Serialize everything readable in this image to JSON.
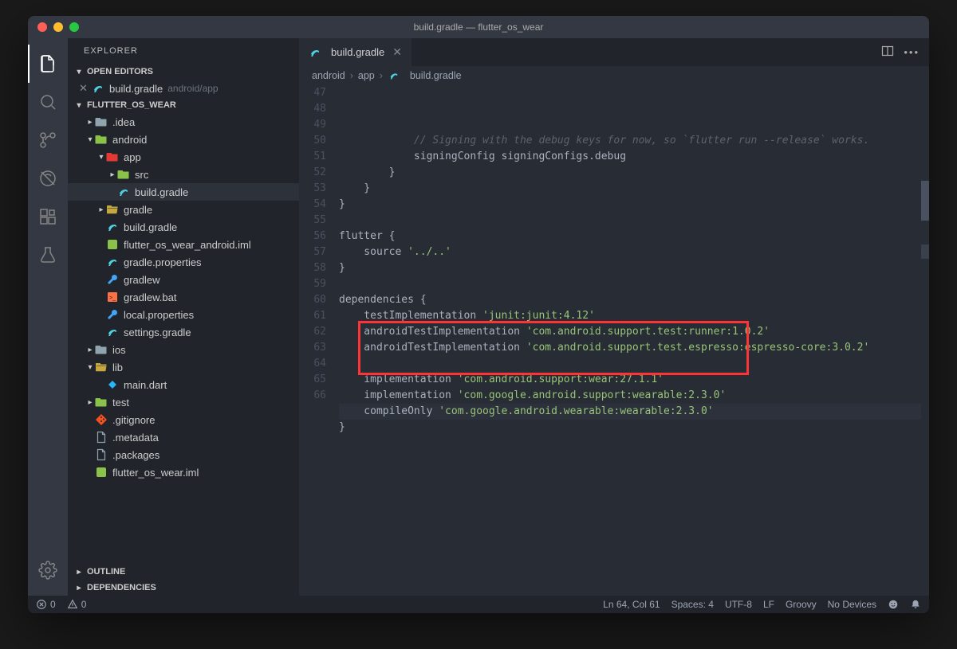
{
  "window": {
    "title": "build.gradle — flutter_os_wear"
  },
  "sidebar": {
    "title": "EXPLORER",
    "sections": {
      "openEditors": "OPEN EDITORS",
      "workspace": "FLUTTER_OS_WEAR",
      "outline": "OUTLINE",
      "dependencies": "DEPENDENCIES"
    },
    "openEditor": {
      "name": "build.gradle",
      "detail": "android/app"
    },
    "tree": [
      {
        "name": ".idea",
        "depth": 1,
        "type": "folder",
        "chev": "▸"
      },
      {
        "name": "android",
        "depth": 1,
        "type": "folder-android",
        "chev": "▾"
      },
      {
        "name": "app",
        "depth": 2,
        "type": "folder-app",
        "chev": "▾"
      },
      {
        "name": "src",
        "depth": 3,
        "type": "folder-android",
        "chev": "▸"
      },
      {
        "name": "build.gradle",
        "depth": 3,
        "type": "gradle",
        "active": true
      },
      {
        "name": "gradle",
        "depth": 2,
        "type": "folder-open",
        "chev": "▸"
      },
      {
        "name": "build.gradle",
        "depth": 2,
        "type": "gradle"
      },
      {
        "name": "flutter_os_wear_android.iml",
        "depth": 2,
        "type": "green"
      },
      {
        "name": "gradle.properties",
        "depth": 2,
        "type": "gradle"
      },
      {
        "name": "gradlew",
        "depth": 2,
        "type": "wrench"
      },
      {
        "name": "gradlew.bat",
        "depth": 2,
        "type": "orange"
      },
      {
        "name": "local.properties",
        "depth": 2,
        "type": "wrench"
      },
      {
        "name": "settings.gradle",
        "depth": 2,
        "type": "gradle"
      },
      {
        "name": "ios",
        "depth": 1,
        "type": "folder",
        "chev": "▸"
      },
      {
        "name": "lib",
        "depth": 1,
        "type": "folder-open",
        "chev": "▾"
      },
      {
        "name": "main.dart",
        "depth": 2,
        "type": "dart"
      },
      {
        "name": "test",
        "depth": 1,
        "type": "folder-android",
        "chev": "▸"
      },
      {
        "name": ".gitignore",
        "depth": 1,
        "type": "git"
      },
      {
        "name": ".metadata",
        "depth": 1,
        "type": "file"
      },
      {
        "name": ".packages",
        "depth": 1,
        "type": "file"
      },
      {
        "name": "flutter_os_wear.iml",
        "depth": 1,
        "type": "green"
      }
    ]
  },
  "tab": {
    "name": "build.gradle"
  },
  "breadcrumbs": [
    "android",
    "app",
    "build.gradle"
  ],
  "code": {
    "startLine": 47,
    "highlightLine": 64,
    "lines": [
      {
        "n": 47,
        "segs": [
          [
            "            ",
            "p"
          ],
          [
            "// Signing with the debug keys for now, so `flutter run --release` works.",
            "c"
          ]
        ]
      },
      {
        "n": 48,
        "segs": [
          [
            "            signingConfig signingConfigs",
            "i"
          ],
          [
            ".",
            "p"
          ],
          [
            "debug",
            "i"
          ]
        ]
      },
      {
        "n": 49,
        "segs": [
          [
            "        }",
            "p"
          ]
        ]
      },
      {
        "n": 50,
        "segs": [
          [
            "    }",
            "p"
          ]
        ]
      },
      {
        "n": 51,
        "segs": [
          [
            "}",
            "p"
          ]
        ]
      },
      {
        "n": 52,
        "segs": [
          [
            "",
            ""
          ]
        ]
      },
      {
        "n": 53,
        "segs": [
          [
            "flutter ",
            "i"
          ],
          [
            "{",
            "p"
          ]
        ]
      },
      {
        "n": 54,
        "segs": [
          [
            "    source ",
            "i"
          ],
          [
            "'../..'",
            "s"
          ]
        ]
      },
      {
        "n": 55,
        "segs": [
          [
            "}",
            "p"
          ]
        ]
      },
      {
        "n": 56,
        "segs": [
          [
            "",
            ""
          ]
        ]
      },
      {
        "n": 57,
        "segs": [
          [
            "dependencies ",
            "i"
          ],
          [
            "{",
            "p"
          ]
        ]
      },
      {
        "n": 58,
        "segs": [
          [
            "    testImplementation ",
            "i"
          ],
          [
            "'junit:junit:4.12'",
            "s"
          ]
        ]
      },
      {
        "n": 59,
        "segs": [
          [
            "    androidTestImplementation ",
            "i"
          ],
          [
            "'com.android.support.test:runner:1.0.2'",
            "s"
          ]
        ]
      },
      {
        "n": 60,
        "segs": [
          [
            "    androidTestImplementation ",
            "i"
          ],
          [
            "'com.android.support.test.espresso:espresso-core:3.0.2'",
            "s"
          ]
        ]
      },
      {
        "n": 61,
        "segs": [
          [
            "",
            ""
          ]
        ]
      },
      {
        "n": 62,
        "segs": [
          [
            "    implementation ",
            "i"
          ],
          [
            "'com.android.support:wear:27.1.1'",
            "s"
          ]
        ]
      },
      {
        "n": 63,
        "segs": [
          [
            "    implementation ",
            "i"
          ],
          [
            "'com.google.android.support:wearable:2.3.0'",
            "s"
          ]
        ]
      },
      {
        "n": 64,
        "segs": [
          [
            "    compileOnly ",
            "i"
          ],
          [
            "'com.google.android.wearable:wearable:2.3.0'",
            "s"
          ]
        ]
      },
      {
        "n": 65,
        "segs": [
          [
            "}",
            "p"
          ]
        ]
      },
      {
        "n": 66,
        "segs": [
          [
            "",
            ""
          ]
        ]
      }
    ],
    "highlightBox": {
      "fromLine": 62,
      "toLine": 64
    }
  },
  "statusbar": {
    "errors": "0",
    "warnings": "0",
    "lineCol": "Ln 64, Col 61",
    "spaces": "Spaces: 4",
    "encoding": "UTF-8",
    "eol": "LF",
    "language": "Groovy",
    "devices": "No Devices"
  }
}
